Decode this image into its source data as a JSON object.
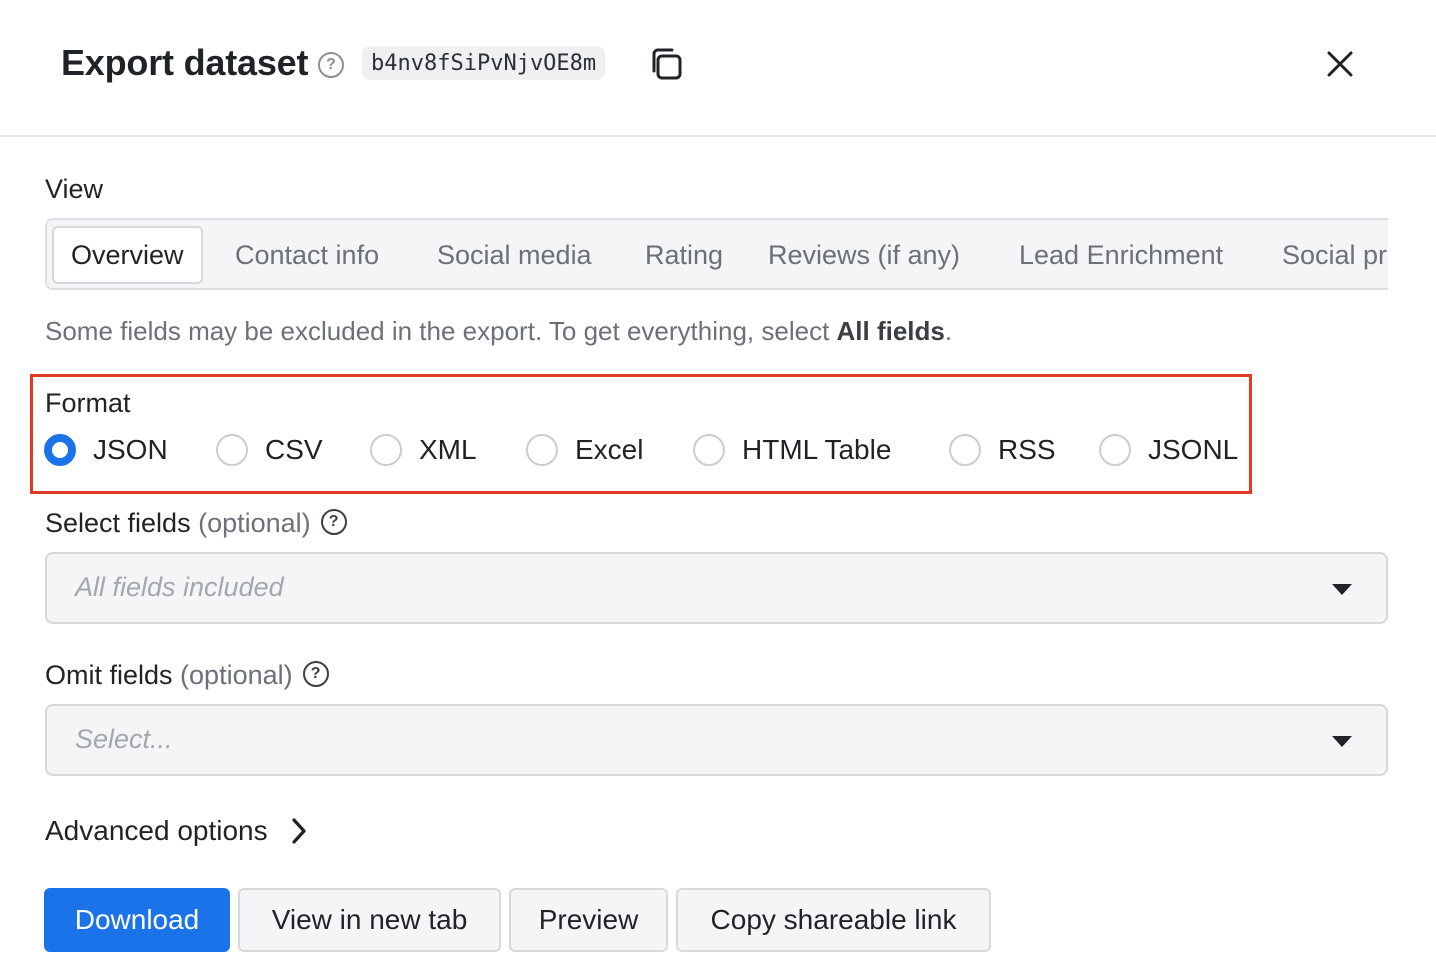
{
  "header": {
    "title": "Export dataset",
    "dataset_id": "b4nv8fSiPvNjvOE8m",
    "help_glyph": "?",
    "copy_icon": "copy-icon",
    "close_icon": "close-icon"
  },
  "view": {
    "label": "View",
    "tabs": [
      {
        "label": "Overview",
        "active": true
      },
      {
        "label": "Contact info",
        "active": false
      },
      {
        "label": "Social media",
        "active": false
      },
      {
        "label": "Rating",
        "active": false
      },
      {
        "label": "Reviews (if any)",
        "active": false
      },
      {
        "label": "Lead Enrichment",
        "active": false
      },
      {
        "label": "Social profiles",
        "active": false
      }
    ],
    "hint_prefix": "Some fields may be excluded in the export. To get everything, select ",
    "hint_emphasis": "All fields",
    "hint_suffix": "."
  },
  "format": {
    "label": "Format",
    "options": [
      {
        "label": "JSON",
        "checked": true
      },
      {
        "label": "CSV",
        "checked": false
      },
      {
        "label": "XML",
        "checked": false
      },
      {
        "label": "Excel",
        "checked": false
      },
      {
        "label": "HTML Table",
        "checked": false
      },
      {
        "label": "RSS",
        "checked": false
      },
      {
        "label": "JSONL",
        "checked": false
      }
    ],
    "highlight_color": "#e23b24"
  },
  "select_fields": {
    "label": "Select fields",
    "optional": "(optional)",
    "placeholder": "All fields included"
  },
  "omit_fields": {
    "label": "Omit fields",
    "optional": "(optional)",
    "placeholder": "Select..."
  },
  "advanced": {
    "label": "Advanced options"
  },
  "actions": {
    "download": "Download",
    "view_new_tab": "View in new tab",
    "preview": "Preview",
    "copy_link": "Copy shareable link"
  },
  "colors": {
    "primary": "#1a73e8",
    "text": "#1f2328",
    "muted": "#6b7079"
  }
}
